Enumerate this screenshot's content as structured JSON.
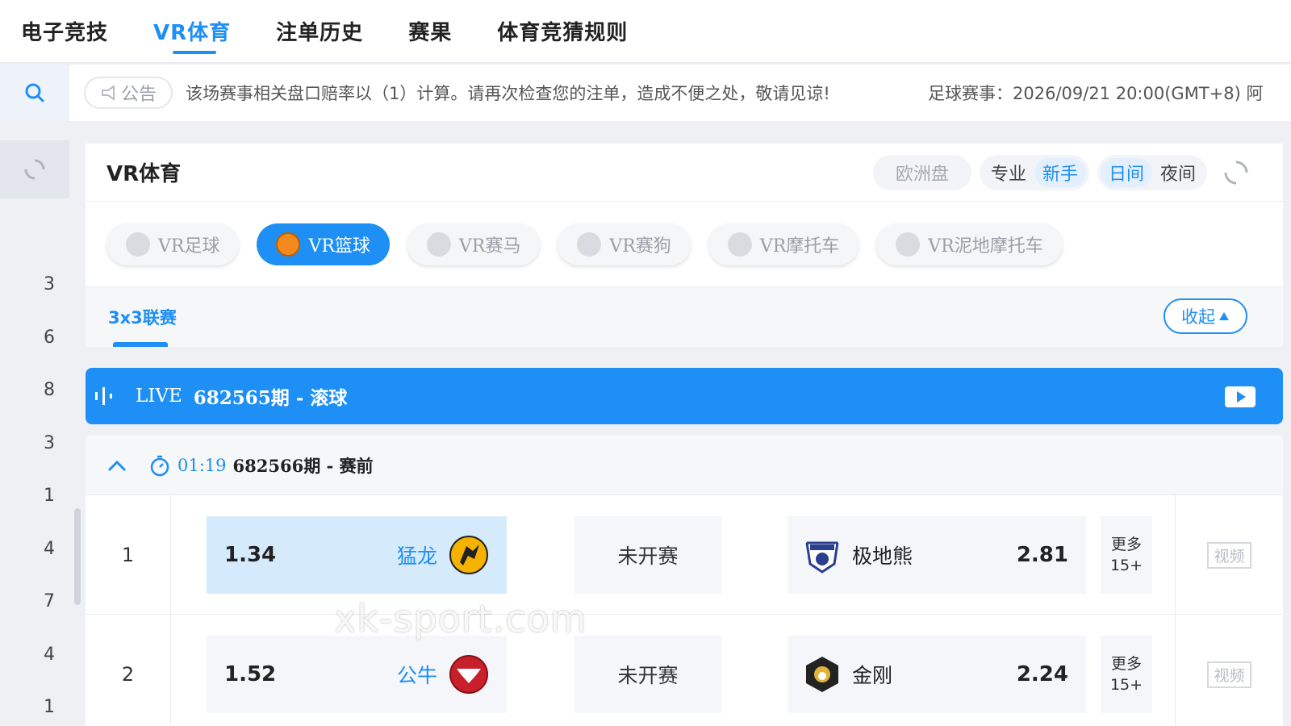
{
  "topnav": {
    "items": [
      {
        "label": "电子竞技",
        "active": false
      },
      {
        "label": "VR体育",
        "active": true
      },
      {
        "label": "注单历史",
        "active": false
      },
      {
        "label": "赛果",
        "active": false
      },
      {
        "label": "体育竞猜规则",
        "active": false
      }
    ]
  },
  "notice": {
    "tag": "公告",
    "text": "该场赛事相关盘口赔率以（1）计算。请再次检查您的注单，造成不便之处，敬请见谅!",
    "text2": "足球赛事：2026/09/21 20:00(GMT+8) 阿"
  },
  "rail": {
    "numbers": [
      "3",
      "6",
      "8",
      "3",
      "1",
      "4",
      "7",
      "4",
      "1"
    ]
  },
  "panel": {
    "title": "VR体育",
    "odds_type": "欧洲盘",
    "mode": {
      "a": "专业",
      "b": "新手"
    },
    "theme": {
      "a": "日间",
      "b": "夜间"
    }
  },
  "sports": [
    {
      "label": "VR足球"
    },
    {
      "label": "VR篮球"
    },
    {
      "label": "VR赛马"
    },
    {
      "label": "VR赛狗"
    },
    {
      "label": "VR摩托车"
    },
    {
      "label": "VR泥地摩托车"
    }
  ],
  "league": {
    "name": "3x3联赛",
    "collapse_label": "收起"
  },
  "live": {
    "label": "LIVE",
    "period": "682565期 - 滚球"
  },
  "upcoming": {
    "timer": "01:19",
    "period": "682566期 - 赛前"
  },
  "matches": [
    {
      "index": "1",
      "home_odds": "1.34",
      "home_team": "猛龙",
      "status": "未开赛",
      "away_team": "极地熊",
      "away_odds": "2.81",
      "more_label": "更多",
      "more_count": "15+",
      "video_label": "视频"
    },
    {
      "index": "2",
      "home_odds": "1.52",
      "home_team": "公牛",
      "status": "未开赛",
      "away_team": "金刚",
      "away_odds": "2.24",
      "more_label": "更多",
      "more_count": "15+",
      "video_label": "视频"
    }
  ],
  "watermark": "xk-sport.com",
  "colors": {
    "accent": "#1e8ff4",
    "selected_bg": "#d5ebfc"
  }
}
